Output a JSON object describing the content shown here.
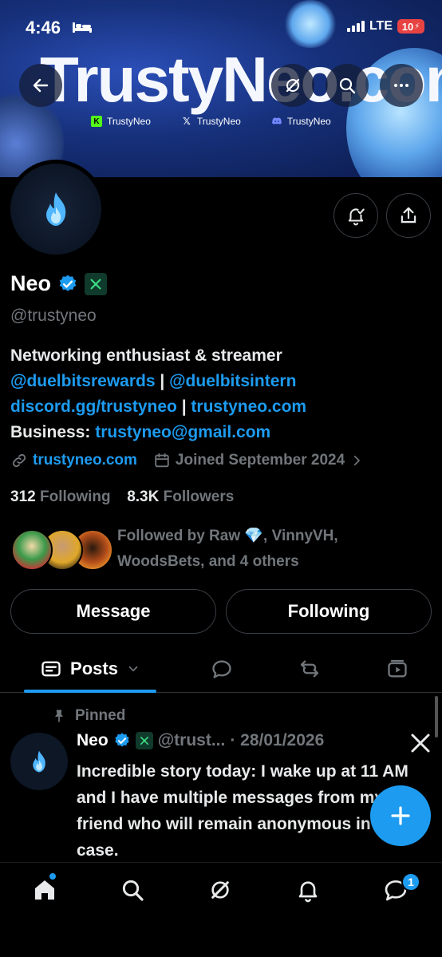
{
  "status_bar": {
    "time": "4:46",
    "network": "LTE",
    "battery": "10"
  },
  "banner": {
    "title": "TrustyNeo.com",
    "socials": [
      {
        "icon": "kick-icon",
        "label": "TrustyNeo"
      },
      {
        "icon": "x-icon",
        "label": "TrustyNeo"
      },
      {
        "icon": "discord-icon",
        "label": "TrustyNeo"
      }
    ]
  },
  "profile": {
    "name": "Neo",
    "handle": "@trustyneo",
    "bio": {
      "line1": "Networking enthusiast & streamer",
      "mention1": "@duelbitsrewards",
      "separator": " | ",
      "mention2": "@duelbitsintern",
      "link1": "discord.gg/trustyneo",
      "link2": "trustyneo.com",
      "business_label": "Business: ",
      "business_email": "trustyneo@gmail.com"
    },
    "website": "trustyneo.com",
    "joined": "Joined September 2024",
    "following_count": "312",
    "following_label": "Following",
    "followers_count": "8.3K",
    "followers_label": "Followers",
    "followed_by": "Followed by Raw 💎, VinnyVH, WoodsBets, and 4 others"
  },
  "actions": {
    "message": "Message",
    "following": "Following"
  },
  "tabs": {
    "posts": "Posts"
  },
  "pinned_post": {
    "pinned_label": "Pinned",
    "author": "Neo",
    "handle": "@trust...",
    "date": "· 28/01/2026",
    "text": "Incredible story today: I wake up at 11 AM and I have multiple messages from my friend who will remain anonymous in this case."
  },
  "nav": {
    "messages_badge": "1"
  },
  "colors": {
    "accent": "#1d9bf0",
    "background": "#000000",
    "muted": "#71767b",
    "battery_low": "#e84343"
  }
}
